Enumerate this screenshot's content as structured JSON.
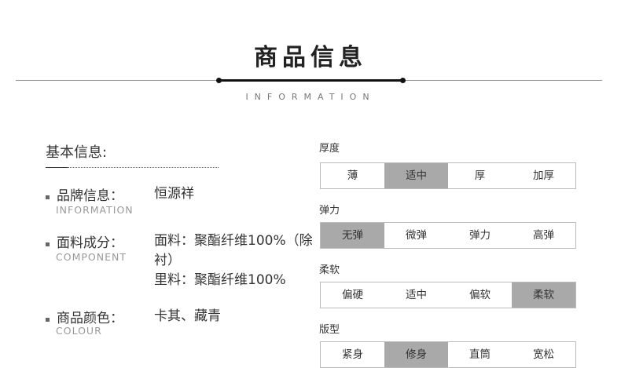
{
  "header": {
    "title": "商品信息",
    "subtitle": "INFORMATION"
  },
  "basic_info": {
    "heading": "基本信息:",
    "items": [
      {
        "label": "品牌信息：",
        "en": "INFORMATION",
        "values": [
          "恒源祥"
        ]
      },
      {
        "label": "面料成分：",
        "en": "COMPONENT",
        "values": [
          "面料：聚酯纤维100%（除",
          "衬）",
          "里料：聚酯纤维100%"
        ]
      },
      {
        "label": "商品颜色：",
        "en": "COLOUR",
        "values": [
          "卡其、藏青"
        ]
      }
    ]
  },
  "attributes": [
    {
      "label": "厚度",
      "options": [
        "薄",
        "适中",
        "厚",
        "加厚"
      ],
      "selected": "适中"
    },
    {
      "label": "弹力",
      "options": [
        "无弹",
        "微弹",
        "弹力",
        "高弹"
      ],
      "selected": "无弹"
    },
    {
      "label": "柔软",
      "options": [
        "偏硬",
        "适中",
        "偏软",
        "柔软"
      ],
      "selected": "柔软"
    },
    {
      "label": "版型",
      "options": [
        "紧身",
        "修身",
        "直筒",
        "宽松"
      ],
      "selected": "修身"
    }
  ],
  "colors": {
    "selected_bg": "#a9a9a9",
    "divider_dark": "#111111",
    "divider_light": "#9a9a9a"
  }
}
